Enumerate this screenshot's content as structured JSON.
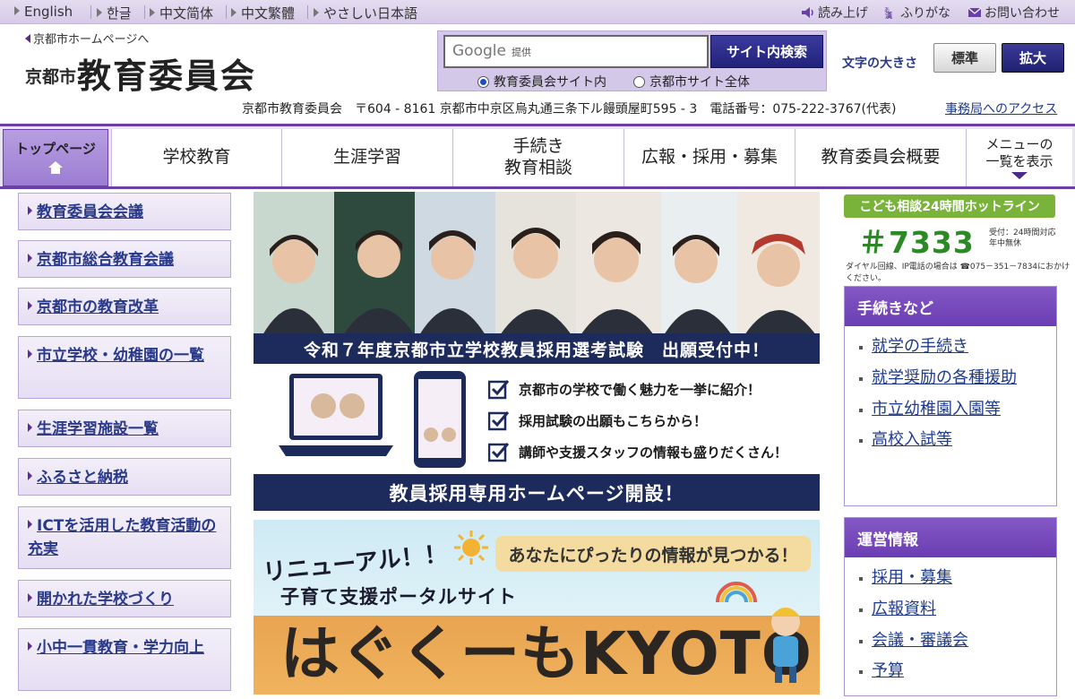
{
  "languages": [
    "English",
    "한글",
    "中文简体",
    "中文繁體",
    "やさしい日本語"
  ],
  "utility": {
    "read_aloud": "読み上げ",
    "furigana": "ふりがな",
    "contact": "お問い合わせ"
  },
  "header": {
    "back_link": "京都市ホームページへ",
    "logo_sub": "京都市",
    "logo_main": "教育委員会"
  },
  "search": {
    "placeholder_brand": "Google",
    "placeholder_note": "提供",
    "button": "サイト内検索",
    "scope_options": [
      "教育委員会サイト内",
      "京都市サイト全体"
    ],
    "selected_scope": "教育委員会サイト内"
  },
  "font_size": {
    "label": "文字の大きさ",
    "standard": "標準",
    "large": "拡大"
  },
  "address": {
    "text": "京都市教育委員会　〒604 - 8161 京都市中京区烏丸通三条下ル饅頭屋町595 - 3　電話番号：075-222-3767(代表)",
    "access_link": "事務局へのアクセス"
  },
  "nav": {
    "top_page": "トップページ",
    "items": [
      "学校教育",
      "生涯学習",
      "手続き\n教育相談",
      "広報・採用・募集",
      "教育委員会概要"
    ],
    "menu_line1": "メニューの",
    "menu_line2": "一覧を表示"
  },
  "side_links": [
    "教育委員会会議",
    "京都市総合教育会議",
    "京都市の教育改革",
    "市立学校・幼稚園の一覧",
    "生涯学習施設一覧",
    "ふるさと納税",
    "ICTを活用した教育活動の充実",
    "開かれた学校づくり",
    "小中一貫教育・学力向上"
  ],
  "banners": {
    "recruit_caption": "令和７年度京都市立学校教員採用選考試験　出願受付中！",
    "checks": [
      "京都市の学校で働く魅力を一挙に紹介！",
      "採用試験の出願もこちらから！",
      "講師や支援スタッフの情報も盛りだくさん！"
    ],
    "site_caption": "教員採用専用ホームページ開設！",
    "portal_renewal": "リニューアル！！",
    "portal_bubble": "あなたにぴったりの情報が見つかる！",
    "portal_sub": "子育て支援ポータルサイト",
    "portal_title": "はぐくーもKYOTO"
  },
  "hotline": {
    "header": "こども相談24時間ホットライン",
    "number": "＃7333",
    "hours_line1": "受付：24時間対応",
    "hours_line2": "年中無休",
    "note": "ダイヤル回線、IP電話の場合は ☎075－351－7834におかけください。"
  },
  "panels": [
    {
      "title": "手続きなど",
      "items": [
        "就学の手続き",
        "就学奨励の各種援助",
        "市立幼稚園入園等",
        "高校入試等"
      ]
    },
    {
      "title": "運営情報",
      "items": [
        "採用・募集",
        "広報資料",
        "会議・審議会",
        "予算"
      ]
    }
  ],
  "colors": {
    "accent": "#6a3fa8",
    "navy": "#1d2a5c",
    "link": "#1e3a8c",
    "hotline_green": "#2b8a24"
  }
}
